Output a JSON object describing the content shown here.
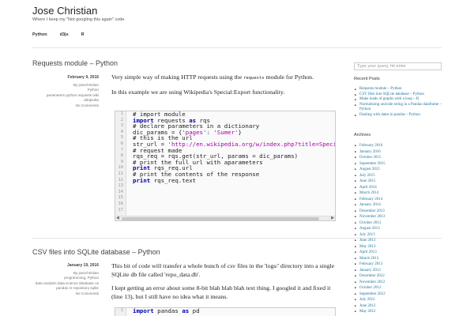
{
  "site": {
    "title": "Jose Christian",
    "description": "Where I keep my \"Not googling this again\" code",
    "nav": [
      "Python",
      "d3js",
      "R"
    ]
  },
  "posts": [
    {
      "title": "Requests module – Python",
      "date": "February 9, 2016",
      "author": "By josechristian",
      "category": "Python",
      "tags": "parameters python requests wiki wikipedia",
      "comments": "No Comments",
      "paragraphs": [
        {
          "before": "Very simple way of making HTTP requests using the ",
          "code": "requests",
          "after": " module for Python."
        },
        {
          "before": "In this example we are using Wikipedia's Special:Export functionality.",
          "code": "",
          "after": ""
        }
      ],
      "code": {
        "line_numbers": [
          "1",
          "2",
          "3",
          "4",
          "5",
          "6",
          "7",
          "8",
          "9",
          "10",
          "11",
          "12",
          "13",
          "14",
          "15",
          "16",
          "17"
        ],
        "lines": [
          "# import module",
          "import requests as rqs",
          "",
          "# declare parameters in a dictionary",
          "dic_params = {'pages': 'Sumer'}",
          "",
          "# this is the url",
          "str_url = 'http://en.wikipedia.org/w/index.php?title=Special:Export'",
          "",
          "# request made",
          "rqs_req = rqs.get(str_url, params = dic_params)",
          "",
          "# print the full url with aparameters",
          "print rqs_req.url",
          "",
          "# print the contents of the response",
          "print rqs_req.text"
        ]
      }
    },
    {
      "title": "CSV files into SQLite database – Python",
      "date": "January 19, 2016",
      "author": "By josechristian",
      "category": "programming, Python",
      "tags": "data analysis data science database os pandas re repository sqlite",
      "comments": "No Comments",
      "paragraphs": [
        {
          "before": "This bit of code will transfer a whole bunch of csv files in the 'logs/' directory into a single SQLite db file called 'repo_data.db'.",
          "code": "",
          "after": ""
        },
        {
          "before": "I kept getting an error about some 8-bit blah blah blah text thing. I googled it and fixed it (line 13), but I still have no idea what it means.",
          "code": "",
          "after": ""
        }
      ],
      "code": {
        "line_numbers": [
          "1"
        ],
        "lines": [
          "import pandas as pd"
        ]
      }
    }
  ],
  "sidebar": {
    "search_placeholder": "Type your query, hit enter",
    "recent_title": "Recent Posts",
    "recent": [
      "Requests module – Python",
      "CSV files into SQLite database – Python",
      "Make loads of graphs with a loop – R",
      "Normalizing unicode string in a Pandas dataframe – Python",
      "Dealing with dates in pandas – Python"
    ],
    "archives_title": "Archives",
    "archives": [
      "February 2016",
      "January 2016",
      "October 2015",
      "September 2015",
      "August 2015",
      "July 2015",
      "June 2015",
      "April 2014",
      "March 2014",
      "February 2014",
      "January 2014",
      "December 2013",
      "November 2013",
      "October 2013",
      "August 2013",
      "July 2013",
      "June 2013",
      "May 2013",
      "April 2013",
      "March 2013",
      "February 2013",
      "January 2013",
      "December 2012",
      "November 2012",
      "October 2012",
      "September 2012",
      "July 2012",
      "June 2012",
      "May 2012"
    ]
  }
}
